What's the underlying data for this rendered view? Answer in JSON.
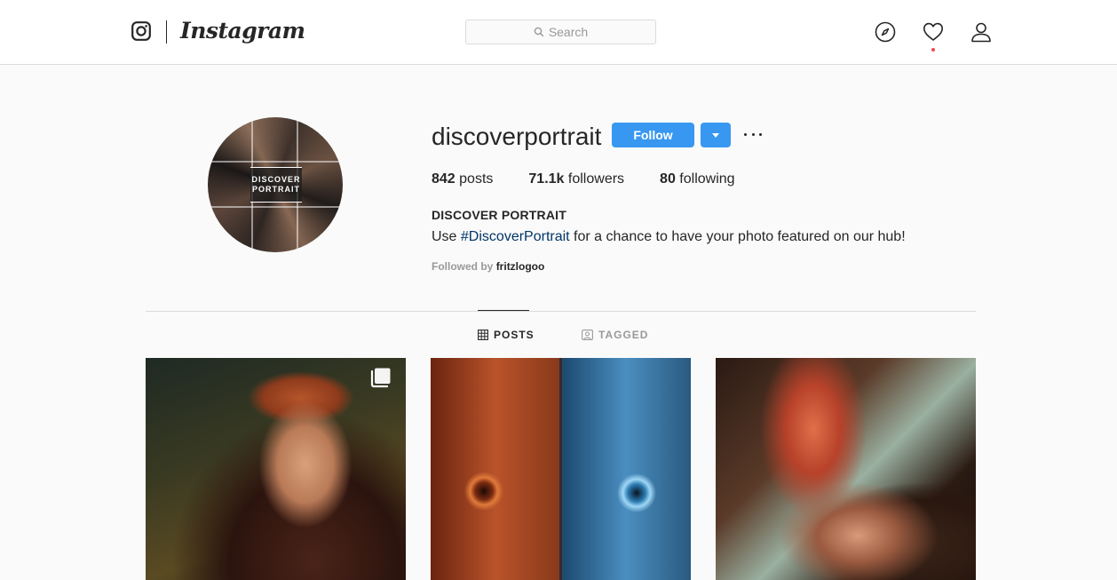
{
  "nav": {
    "wordmark": "Instagram",
    "search_placeholder": "Search",
    "icons": [
      "instagram-glyph-icon",
      "search-icon",
      "explore-compass-icon",
      "activity-heart-icon",
      "profile-person-icon"
    ],
    "notification_dot_color": "#ed4956"
  },
  "profile": {
    "username": "discoverportrait",
    "follow_label": "Follow",
    "avatar_text_line1": "DISCOVER",
    "avatar_text_line2": "PORTRAIT",
    "stats": {
      "posts_count": "842",
      "posts_label": "posts",
      "followers_count": "71.1k",
      "followers_label": "followers",
      "following_count": "80",
      "following_label": "following"
    },
    "full_name": "DISCOVER PORTRAIT",
    "bio_prefix": "Use ",
    "bio_hashtag": "#DiscoverPortrait",
    "bio_suffix": " for a chance to have your photo featured on our hub!",
    "followed_by_label": "Followed by",
    "followed_by_user": "fritzlogoo"
  },
  "tabs": [
    {
      "label": "POSTS",
      "active": true
    },
    {
      "label": "TAGGED",
      "active": false
    }
  ],
  "colors": {
    "accent": "#3897f0",
    "hashtag": "#003569",
    "muted": "#999999",
    "text": "#262626",
    "border": "#dbdbdb"
  },
  "posts": [
    {
      "kind": "carousel"
    },
    {
      "kind": "single"
    },
    {
      "kind": "single"
    }
  ]
}
